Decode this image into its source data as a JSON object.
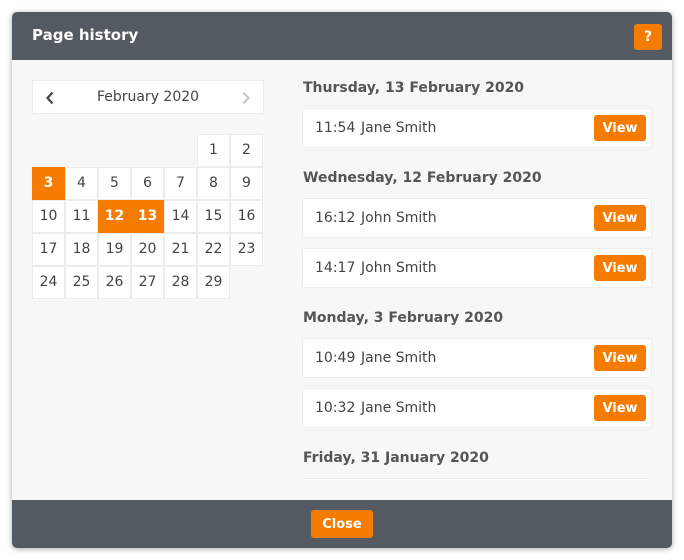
{
  "dialog": {
    "title": "Page history",
    "help_label": "?",
    "close_label": "Close"
  },
  "calendar": {
    "month_label": "February 2020",
    "days": [
      "1",
      "2",
      "3",
      "4",
      "5",
      "6",
      "7",
      "8",
      "9",
      "10",
      "11",
      "12",
      "13",
      "14",
      "15",
      "16",
      "17",
      "18",
      "19",
      "20",
      "21",
      "22",
      "23",
      "24",
      "25",
      "26",
      "27",
      "28",
      "29"
    ],
    "highlighted_days": [
      "3",
      "12",
      "13"
    ]
  },
  "history": {
    "groups": [
      {
        "date": "Thursday, 13 February 2020",
        "entries": [
          {
            "time": "11:54",
            "user": "Jane Smith",
            "action": "View"
          }
        ]
      },
      {
        "date": "Wednesday, 12 February 2020",
        "entries": [
          {
            "time": "16:12",
            "user": "John Smith",
            "action": "View"
          },
          {
            "time": "14:17",
            "user": "John Smith",
            "action": "View"
          }
        ]
      },
      {
        "date": "Monday, 3 February 2020",
        "entries": [
          {
            "time": "10:49",
            "user": "Jane Smith",
            "action": "View"
          },
          {
            "time": "10:32",
            "user": "Jane Smith",
            "action": "View"
          }
        ]
      },
      {
        "date": "Friday, 31 January 2020",
        "entries": []
      }
    ]
  },
  "colors": {
    "accent": "#f57c00",
    "chrome": "#545a62",
    "panel": "#f7f7f7"
  }
}
